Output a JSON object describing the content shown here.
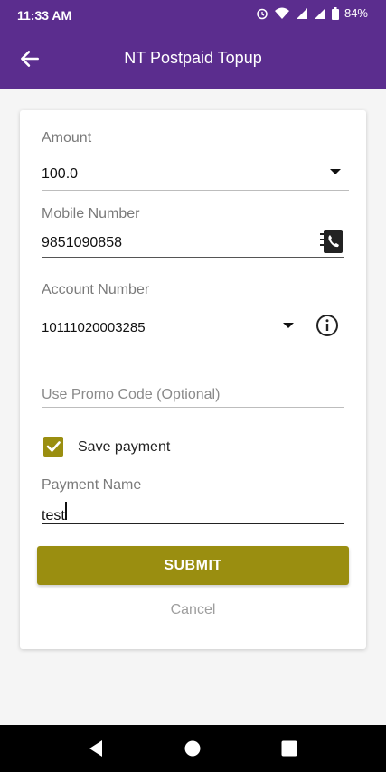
{
  "status_bar": {
    "time": "11:33 AM",
    "battery": "84%"
  },
  "app_bar": {
    "title": "NT Postpaid Topup"
  },
  "form": {
    "amount_label": "Amount",
    "amount_value": "100.0",
    "mobile_label": "Mobile Number",
    "mobile_value": "9851090858",
    "account_label": "Account Number",
    "account_value": "10111020003285",
    "promo_placeholder": "Use Promo Code (Optional)",
    "save_payment_label": "Save payment",
    "save_payment_checked": true,
    "payment_name_label": "Payment Name",
    "payment_name_value": "test",
    "submit_label": "SUBMIT",
    "cancel_label": "Cancel"
  },
  "colors": {
    "header": "#5b2d8e",
    "accent": "#9a8e10"
  },
  "icons": {
    "back": "arrow-left-icon",
    "contact": "contact-phone-icon",
    "info": "info-icon",
    "dropdown": "caret-down-icon",
    "check": "check-icon"
  }
}
